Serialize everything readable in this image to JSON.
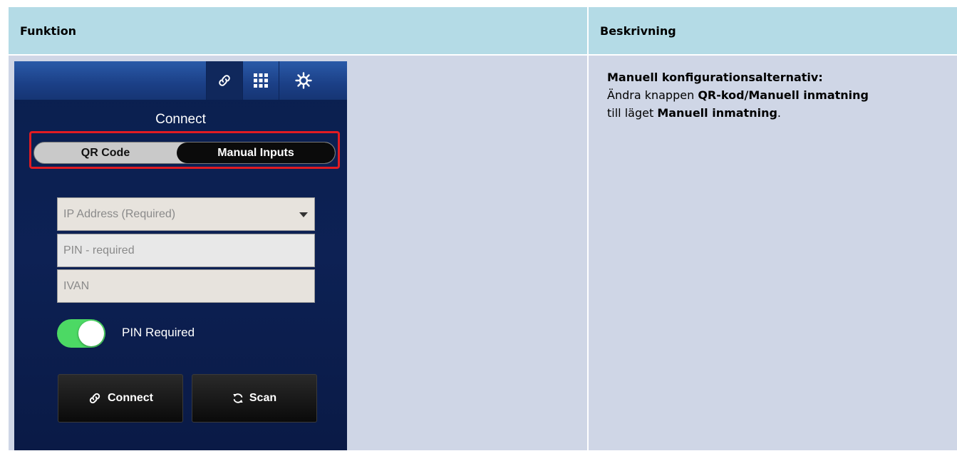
{
  "table": {
    "col1_header": "Funktion",
    "col2_header": "Beskrivning"
  },
  "phone": {
    "title": "Connect",
    "segment": {
      "left_label": "QR Code",
      "right_label": "Manual Inputs",
      "selected": "Manual Inputs"
    },
    "fields": {
      "ip_placeholder": "IP Address (Required)",
      "pin_placeholder": "PIN - required",
      "ivan_placeholder": "IVAN"
    },
    "toggle": {
      "label": "PIN Required",
      "on": true
    },
    "buttons": {
      "connect_label": "Connect",
      "scan_label": "Scan"
    },
    "icons": [
      "link-icon",
      "grid-icon",
      "gear-icon",
      "dropdown-caret-icon",
      "refresh-icon"
    ],
    "colors": {
      "toggle_on": "#4cd964",
      "highlight": "#e11b22",
      "background": "#0d2154"
    }
  },
  "description": {
    "heading": "Manuell konfigurationsalternativ:",
    "line1_pre": "Ändra knappen ",
    "line1_bold": "QR-kod/Manuell inmatning",
    "line2_pre": "till läget ",
    "line2_bold": "Manuell inmatning",
    "line2_post": "."
  }
}
